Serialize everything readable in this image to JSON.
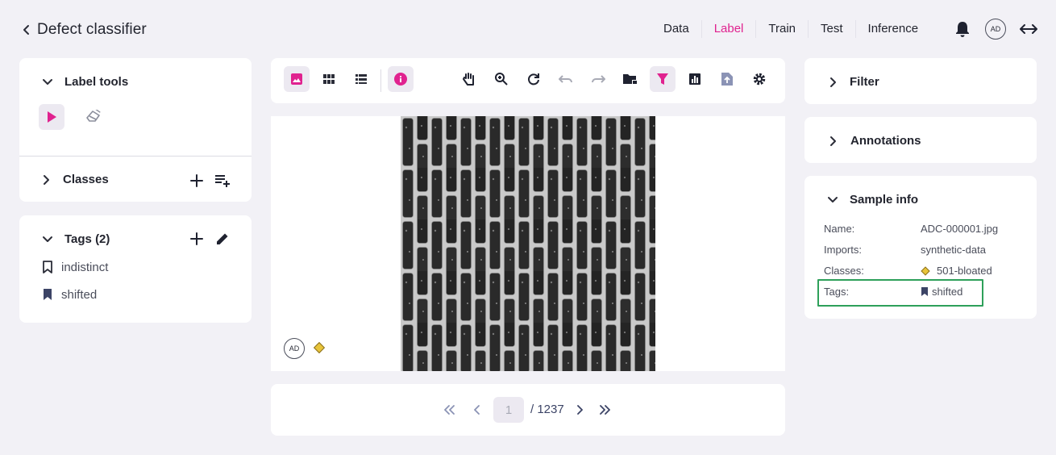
{
  "header": {
    "title": "Defect classifier",
    "nav": [
      "Data",
      "Label",
      "Train",
      "Test",
      "Inference"
    ],
    "active_nav": "Label",
    "avatar": "AD"
  },
  "left": {
    "label_tools": "Label tools",
    "classes": "Classes",
    "tags_title": "Tags (2)",
    "tags": [
      "indistinct",
      "shifted"
    ]
  },
  "viewer": {
    "annotator_avatar": "AD",
    "class_color": "#e8c43a"
  },
  "pagination": {
    "current": "1",
    "total": "/ 1237"
  },
  "right": {
    "filter": "Filter",
    "annotations": "Annotations",
    "sample_info": "Sample info",
    "fields": {
      "name_label": "Name:",
      "name": "ADC-000001.jpg",
      "imports_label": "Imports:",
      "imports": "synthetic-data",
      "classes_label": "Classes:",
      "classes": "501-bloated",
      "tags_label": "Tags:",
      "tags": "shifted"
    }
  },
  "colors": {
    "accent": "#e0228f",
    "highlight_box": "#2ea05a",
    "background": "#f2f1f6"
  }
}
